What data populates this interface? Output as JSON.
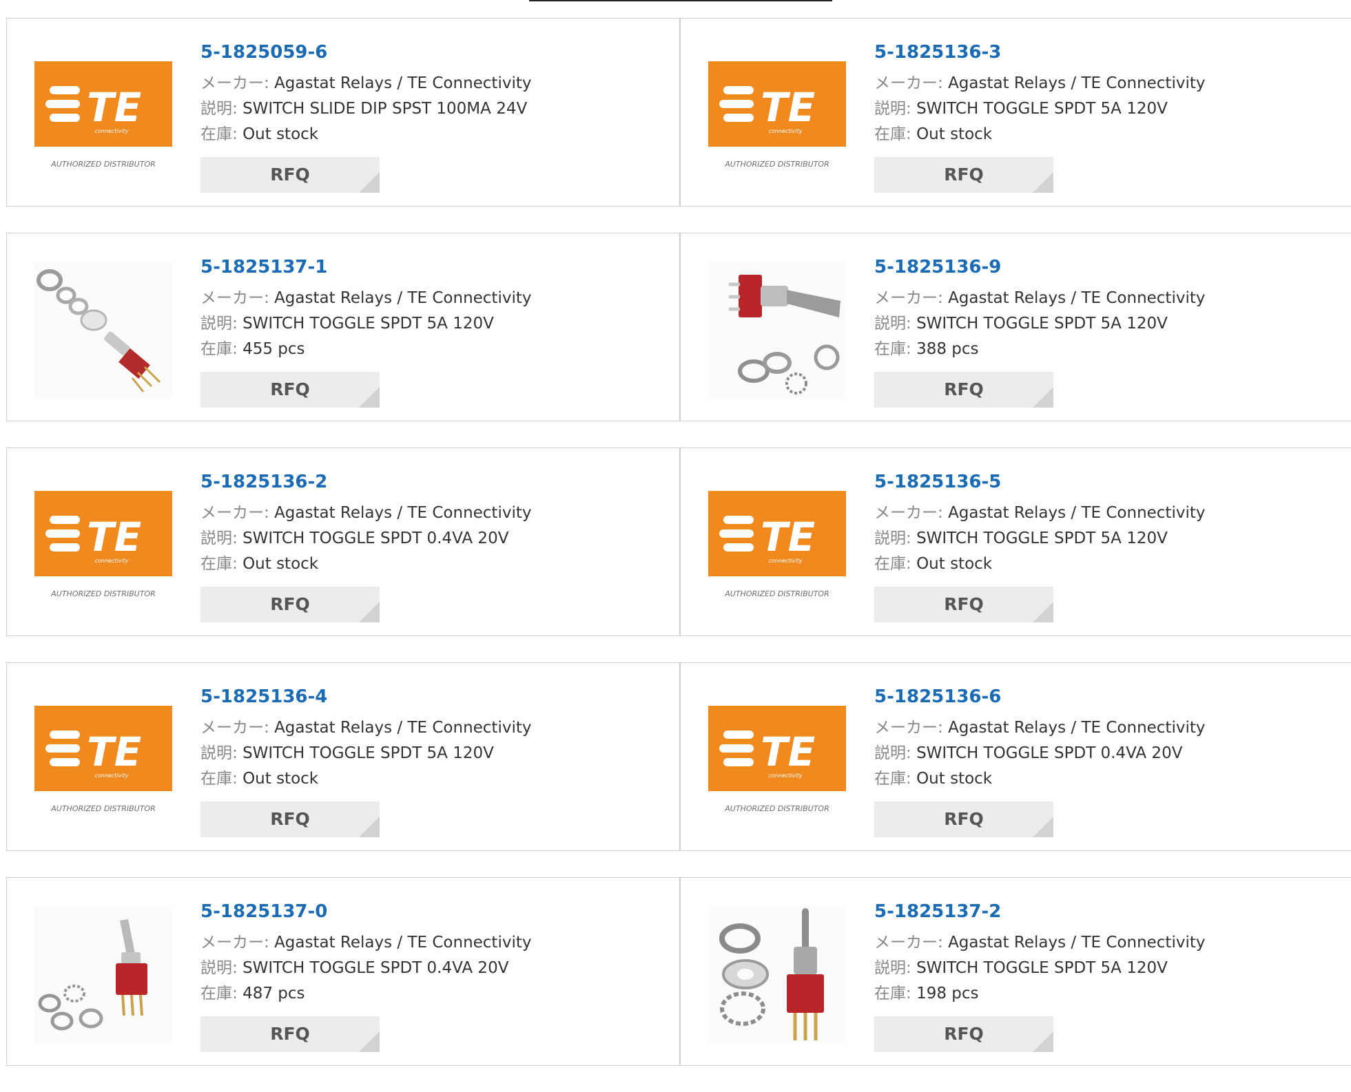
{
  "labels": {
    "manufacturer": "メーカー:",
    "description": "説明:",
    "stock": "在庫:",
    "rfq": "RFQ"
  },
  "logo": {
    "brand": "TE",
    "tagline": "connectivity",
    "caption": "AUTHORIZED DISTRIBUTOR",
    "brand_color": "#f0891e"
  },
  "colors": {
    "part_link": "#1a6bb3",
    "card_border": "#cfcfcf",
    "rfq_bg": "#ececec"
  },
  "products": [
    {
      "part": "5-1825059-6",
      "manufacturer": "Agastat Relays / TE Connectivity",
      "description": "SWITCH SLIDE DIP SPST 100MA 24V",
      "stock": "Out stock",
      "image": "te-logo"
    },
    {
      "part": "5-1825136-3",
      "manufacturer": "Agastat Relays / TE Connectivity",
      "description": "SWITCH TOGGLE SPDT 5A 120V",
      "stock": "Out stock",
      "image": "te-logo"
    },
    {
      "part": "5-1825137-1",
      "manufacturer": "Agastat Relays / TE Connectivity",
      "description": "SWITCH TOGGLE SPDT 5A 120V",
      "stock": "455 pcs",
      "image": "toggle-switch-photo"
    },
    {
      "part": "5-1825136-9",
      "manufacturer": "Agastat Relays / TE Connectivity",
      "description": "SWITCH TOGGLE SPDT 5A 120V",
      "stock": "388 pcs",
      "image": "toggle-switch-photo"
    },
    {
      "part": "5-1825136-2",
      "manufacturer": "Agastat Relays / TE Connectivity",
      "description": "SWITCH TOGGLE SPDT 0.4VA 20V",
      "stock": "Out stock",
      "image": "te-logo"
    },
    {
      "part": "5-1825136-5",
      "manufacturer": "Agastat Relays / TE Connectivity",
      "description": "SWITCH TOGGLE SPDT 5A 120V",
      "stock": "Out stock",
      "image": "te-logo"
    },
    {
      "part": "5-1825136-4",
      "manufacturer": "Agastat Relays / TE Connectivity",
      "description": "SWITCH TOGGLE SPDT 5A 120V",
      "stock": "Out stock",
      "image": "te-logo"
    },
    {
      "part": "5-1825136-6",
      "manufacturer": "Agastat Relays / TE Connectivity",
      "description": "SWITCH TOGGLE SPDT 0.4VA 20V",
      "stock": "Out stock",
      "image": "te-logo"
    },
    {
      "part": "5-1825137-0",
      "manufacturer": "Agastat Relays / TE Connectivity",
      "description": "SWITCH TOGGLE SPDT 0.4VA 20V",
      "stock": "487 pcs",
      "image": "toggle-switch-photo"
    },
    {
      "part": "5-1825137-2",
      "manufacturer": "Agastat Relays / TE Connectivity",
      "description": "SWITCH TOGGLE SPDT 5A 120V",
      "stock": "198 pcs",
      "image": "toggle-switch-photo"
    }
  ]
}
